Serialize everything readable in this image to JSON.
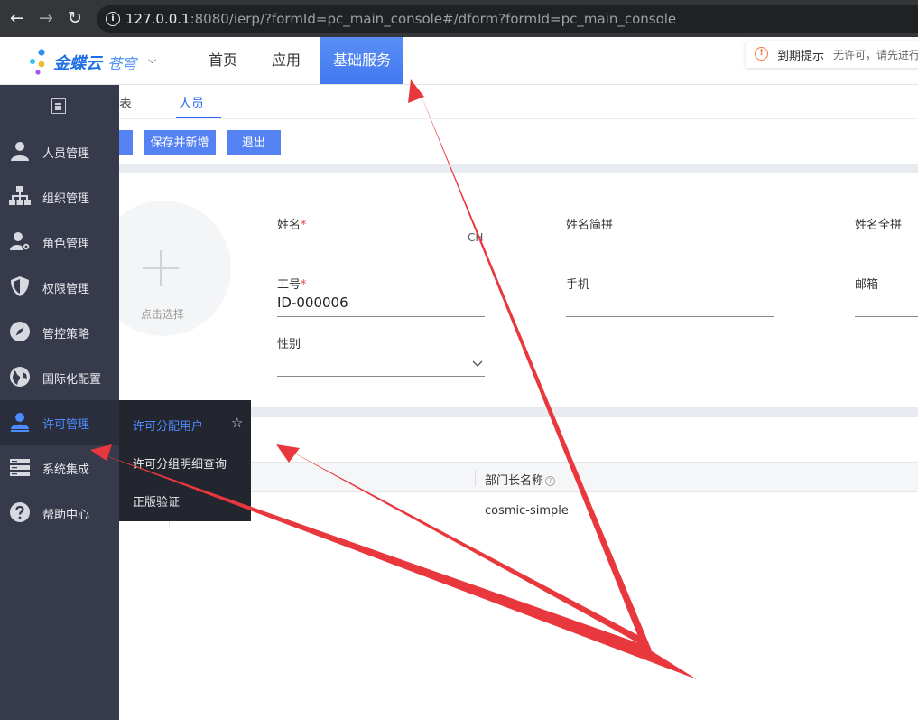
{
  "browser": {
    "url_host": "127.0.0.1",
    "url_rest": ":8080/ierp/?formId=pc_main_console#/dform?formId=pc_main_console"
  },
  "header": {
    "logo_main": "金蝶云",
    "logo_sub": "苍穹",
    "nav": [
      "首页",
      "应用",
      "基础服务"
    ],
    "expiry_title": "到期提示",
    "expiry_text": "无许可，请先进行"
  },
  "tabs": [
    "表",
    "人员"
  ],
  "toolbar": {
    "save_new": "保存并新增",
    "exit": "退出"
  },
  "form": {
    "avatar_label": "点击选择",
    "name_label": "姓名",
    "name_partial": "CH",
    "pinyin_short_label": "姓名简拼",
    "pinyin_full_label": "姓名全拼",
    "number_label": "工号",
    "number_value": "ID-000006",
    "mobile_label": "手机",
    "email_label": "邮箱",
    "gender_label": "性别",
    "required_mark": "*"
  },
  "table": {
    "column_head": "部门长名称",
    "help_glyph": "?",
    "row_value": "cosmic-simple"
  },
  "sidebar": {
    "items": [
      {
        "label": "人员管理",
        "icon": "person-icon"
      },
      {
        "label": "组织管理",
        "icon": "org-tree-icon"
      },
      {
        "label": "角色管理",
        "icon": "user-gear-icon"
      },
      {
        "label": "权限管理",
        "icon": "shield-icon"
      },
      {
        "label": "管控策略",
        "icon": "compass-icon"
      },
      {
        "label": "国际化配置",
        "icon": "globe-icon"
      },
      {
        "label": "许可管理",
        "icon": "license-user-icon",
        "active": true
      },
      {
        "label": "系统集成",
        "icon": "server-icon"
      },
      {
        "label": "帮助中心",
        "icon": "help-icon"
      }
    ],
    "submenu": [
      "许可分配用户",
      "许可分组明细查询",
      "正版验证"
    ]
  },
  "colors": {
    "accent": "#4c8cff",
    "sidebar_bg": "#363a4b",
    "annotation_arrow": "#e8383d"
  }
}
